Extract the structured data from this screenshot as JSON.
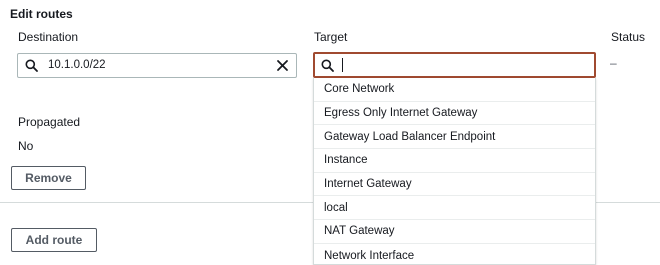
{
  "section": {
    "title": "Edit routes"
  },
  "columns": {
    "destination": "Destination",
    "target": "Target",
    "status": "Status"
  },
  "destination_input": {
    "value": "10.1.0.0/22"
  },
  "target_input": {
    "value": ""
  },
  "status_value": "–",
  "propagated": {
    "label": "Propagated",
    "value": "No"
  },
  "buttons": {
    "remove": "Remove",
    "add_route": "Add route"
  },
  "dropdown": {
    "options": [
      "Core Network",
      "Egress Only Internet Gateway",
      "Gateway Load Balancer Endpoint",
      "Instance",
      "Internet Gateway",
      "local",
      "NAT Gateway",
      "Network Interface"
    ]
  },
  "icons": {
    "search": "search-icon",
    "clear": "close-icon"
  },
  "colors": {
    "focus_border": "#a04a30",
    "divider": "#d5dbdb"
  }
}
